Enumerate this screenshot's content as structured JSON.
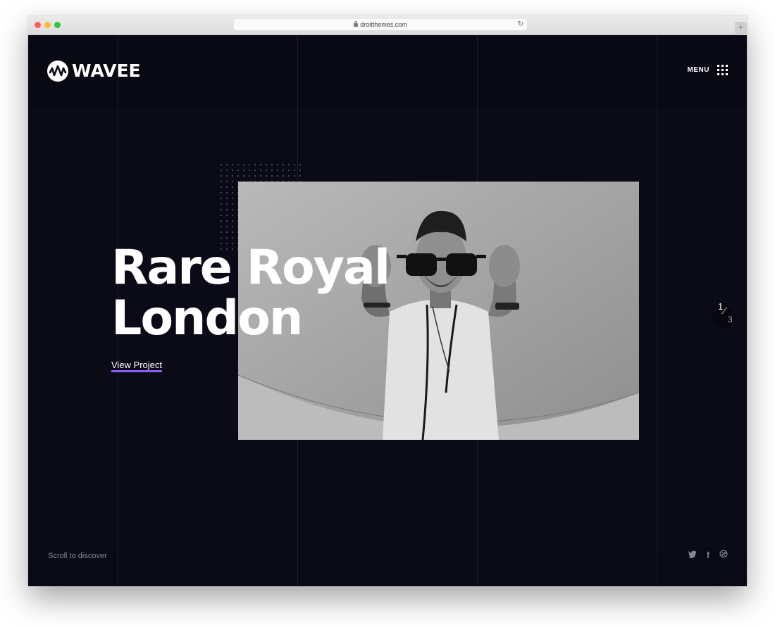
{
  "browser": {
    "url": "droitthemes.com",
    "reload_icon": "reload-icon",
    "new_tab_icon": "plus-icon",
    "new_tab_glyph": "+"
  },
  "site": {
    "logo_text": "WAVEE",
    "menu_label": "MENU"
  },
  "hero": {
    "title_line1": "Rare Royal",
    "title_line2": "London",
    "cta_label": "View Project",
    "cta_underline_color": "#8b5cf6"
  },
  "slider": {
    "current": "1",
    "total": "3"
  },
  "footer": {
    "scroll_text": "Scroll to discover",
    "social": [
      {
        "icon": "twitter-icon",
        "glyph": "🐦"
      },
      {
        "icon": "facebook-icon",
        "glyph": "f"
      },
      {
        "icon": "dribbble-icon",
        "glyph": "◎"
      }
    ]
  },
  "colors": {
    "background": "#0b0b18",
    "text": "#ffffff",
    "muted": "#8a8a96",
    "accent": "#8b5cf6"
  }
}
